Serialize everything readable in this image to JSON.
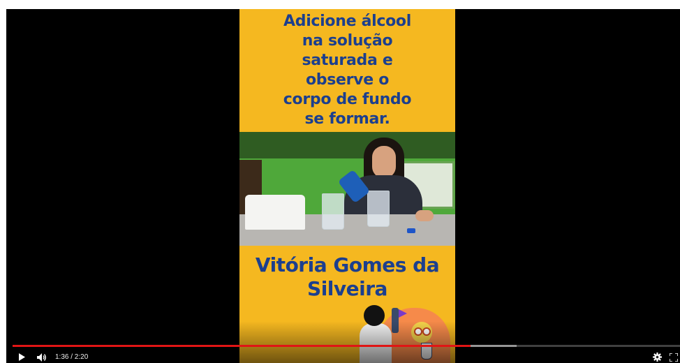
{
  "video": {
    "caption_top": [
      "Adicione álcool",
      "na solução",
      "saturada e",
      "observe o",
      "corpo de fundo",
      "se formar."
    ],
    "caption_bottom": [
      "Vitória Gomes da",
      "Silveira"
    ]
  },
  "player": {
    "current_time": "1:36",
    "duration": "2:20",
    "time_display": "1:36 / 2:20",
    "progress_fraction": 0.686,
    "buffered_fraction": 0.755
  },
  "colors": {
    "frame_background": "#f5b820",
    "caption_text": "#1c3f8e",
    "progress_played": "#e01515"
  },
  "icons": {
    "play": "play-icon",
    "volume": "volume-icon",
    "settings": "gear-icon",
    "fullscreen": "fullscreen-icon"
  }
}
